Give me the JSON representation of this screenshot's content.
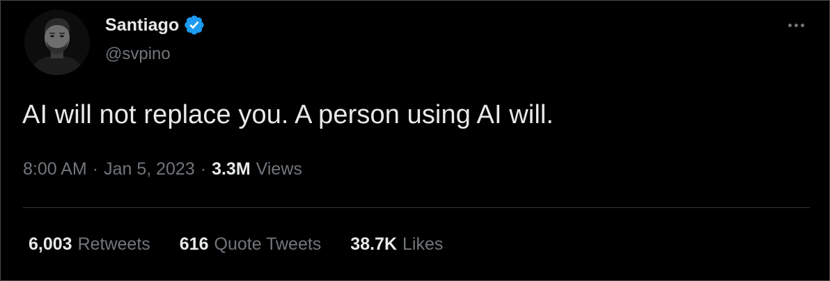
{
  "author": {
    "display_name": "Santiago",
    "handle": "@svpino",
    "verified": true,
    "verified_color": "#1d9bf0",
    "avatar_icon": "profile-photo"
  },
  "more_icon": "more-horizontal-icon",
  "tweet": {
    "text": "AI will not replace you. A person using AI will."
  },
  "meta": {
    "time": "8:00 AM",
    "separator": "·",
    "date": "Jan 5, 2023",
    "views_count": "3.3M",
    "views_label": "Views"
  },
  "stats": {
    "retweets_count": "6,003",
    "retweets_label": "Retweets",
    "quotes_count": "616",
    "quotes_label": "Quote Tweets",
    "likes_count": "38.7K",
    "likes_label": "Likes"
  },
  "colors": {
    "background": "#000000",
    "primary_text": "#e7e9ea",
    "secondary_text": "#71767b",
    "divider": "#333639"
  }
}
